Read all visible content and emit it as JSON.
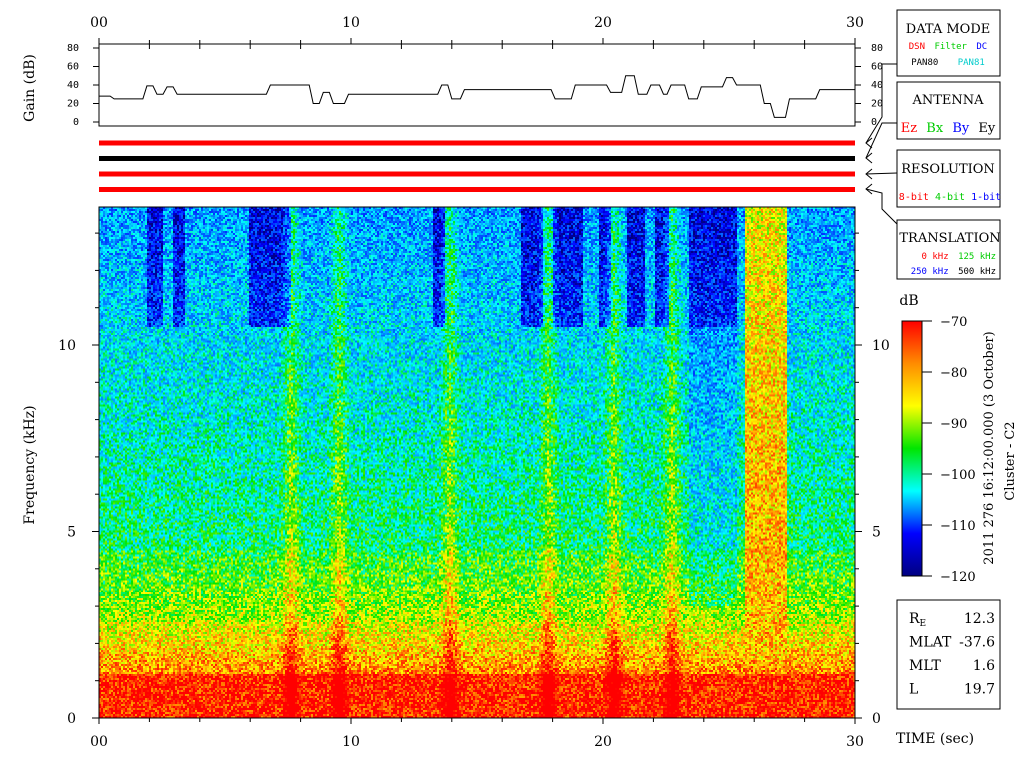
{
  "chart_data": {
    "type": "heatmap",
    "title": "2011 276 16:12:00.000 (3 October)",
    "subtitle": "Cluster - C2",
    "xlabel": "TIME (sec)",
    "xlim": [
      0,
      30
    ],
    "x_ticks": [
      "00",
      "10",
      "20",
      "30"
    ],
    "ylabel": "Frequency (kHz)",
    "ylim": [
      0,
      13.7
    ],
    "y_ticks": [
      "0",
      "5",
      "10"
    ],
    "colorbar": {
      "label": "dB",
      "range": [
        -120,
        -70
      ],
      "ticks": [
        "-70",
        "-80",
        "-90",
        "-100",
        "-110",
        "-120"
      ],
      "colors": [
        "#ff0000",
        "#ff8c00",
        "#ffff00",
        "#00e600",
        "#00ffff",
        "#0000ff",
        "#000080"
      ]
    },
    "gain_panel": {
      "ylabel": "Gain (dB)",
      "ylim": [
        0,
        80
      ],
      "y_ticks": [
        "80",
        "60",
        "40",
        "20",
        "0"
      ],
      "series": {
        "t": [
          0,
          0.6,
          1.6,
          1.9,
          2.3,
          2.7,
          3.1,
          3.4,
          5.9,
          6.8,
          7.4,
          8.5,
          8.9,
          9.3,
          9.9,
          12.4,
          13.2,
          13.6,
          14.0,
          14.5,
          17.6,
          18.1,
          18.9,
          19.6,
          20.3,
          20.9,
          21.4,
          21.9,
          22.4,
          22.7,
          23.4,
          23.9,
          24.4,
          24.9,
          25.3,
          25.8,
          26.4,
          26.8,
          27.4,
          28.6,
          30.0
        ],
        "gain": [
          28,
          25,
          25,
          39,
          30,
          38,
          30,
          30,
          30,
          40,
          40,
          20,
          32,
          20,
          30,
          30,
          30,
          40,
          25,
          35,
          35,
          25,
          40,
          40,
          32,
          50,
          30,
          40,
          30,
          40,
          25,
          38,
          38,
          48,
          40,
          40,
          20,
          5,
          25,
          35,
          35
        ]
      }
    },
    "status_bars": [
      {
        "row": 1,
        "color": "#ff0000"
      },
      {
        "row": 2,
        "color": "#000000"
      },
      {
        "row": 3,
        "color": "#ff0000"
      },
      {
        "row": 4,
        "color": "#ff0000"
      }
    ],
    "features": {
      "strong_emission_band_t": [
        25.6,
        27.3
      ],
      "quiet_high_freq_patches_t": [
        [
          1.9,
          2.5
        ],
        [
          2.9,
          3.4
        ],
        [
          5.9,
          7.6
        ],
        [
          13.2,
          13.7
        ],
        [
          16.7,
          17.6
        ],
        [
          18.0,
          19.2
        ],
        [
          19.8,
          20.3
        ],
        [
          20.9,
          21.6
        ],
        [
          22.0,
          22.6
        ],
        [
          23.4,
          25.3
        ]
      ],
      "green_streaks_t": [
        7.6,
        9.5,
        13.9,
        17.8,
        20.4,
        22.7
      ]
    }
  },
  "legend": {
    "data_mode": {
      "title": "DATA MODE",
      "items": [
        {
          "text": "DSN",
          "color": "#ff0000"
        },
        {
          "text": "Filter",
          "color": "#00cc00"
        },
        {
          "text": "DC",
          "color": "#0000ff"
        },
        {
          "text": "PAN80",
          "color": "#000000"
        },
        {
          "text": "PAN81",
          "color": "#00cccc"
        }
      ]
    },
    "antenna": {
      "title": "ANTENNA",
      "items": [
        {
          "text": "Ez",
          "color": "#ff0000"
        },
        {
          "text": "Bx",
          "color": "#00cc00"
        },
        {
          "text": "By",
          "color": "#0000ff"
        },
        {
          "text": "Ey",
          "color": "#000000"
        }
      ]
    },
    "resolution": {
      "title": "RESOLUTION",
      "items": [
        {
          "text": "8-bit",
          "color": "#ff0000"
        },
        {
          "text": "4-bit",
          "color": "#00cc00"
        },
        {
          "text": "1-bit",
          "color": "#0000ff"
        }
      ]
    },
    "translation": {
      "title": "TRANSLATION",
      "items": [
        {
          "text": "0 kHz",
          "color": "#ff0000"
        },
        {
          "text": "125 kHz",
          "color": "#00cc00"
        },
        {
          "text": "250 kHz",
          "color": "#0000ff"
        },
        {
          "text": "500 kHz",
          "color": "#000000"
        }
      ]
    }
  },
  "orbit": {
    "rows": [
      {
        "label": "R",
        "sub": "E",
        "value": "12.3"
      },
      {
        "label": "MLAT",
        "sub": "",
        "value": "-37.6"
      },
      {
        "label": "MLT",
        "sub": "",
        "value": "1.6"
      },
      {
        "label": "L",
        "sub": "",
        "value": "19.7"
      }
    ]
  }
}
